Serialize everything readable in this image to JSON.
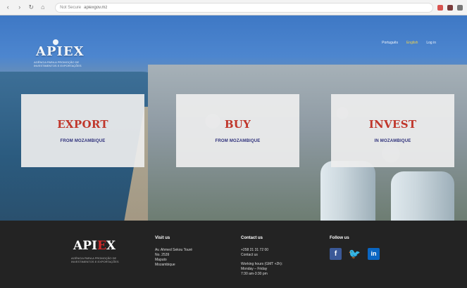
{
  "browser": {
    "address": "apiexgov.mz",
    "secure_label": "Not Secure",
    "nav": {
      "back": "‹",
      "forward": "›",
      "refresh": "↻",
      "home": "⌂"
    },
    "icon_colors": [
      "#d9534f",
      "#7a3b3b",
      "#777777"
    ]
  },
  "header": {
    "logo_text": "APIEX",
    "logo_sub": "AGÊNCIA PARA A PROMOÇÃO DE INVESTIMENTOS E EXPORTAÇÕES",
    "links": [
      {
        "label": "Português",
        "active": false
      },
      {
        "label": "English",
        "active": true
      },
      {
        "label": "Log in",
        "active": false
      }
    ]
  },
  "cards": [
    {
      "title": "EXPORT",
      "subtitle": "FROM MOZAMBIQUE"
    },
    {
      "title": "BUY",
      "subtitle": "FROM MOZAMBIQUE"
    },
    {
      "title": "INVEST",
      "subtitle": "IN MOZAMBIQUE"
    }
  ],
  "footer": {
    "logo_text": {
      "prefix": "API",
      "accent": "E",
      "suffix": "X"
    },
    "logo_tag": "AGÊNCIA PARA A PROMOÇÃO DE INVESTIMENTOS E EXPORTAÇÕES",
    "visit": {
      "title": "Visit us",
      "lines": [
        "Av. Ahmed Sekou Touré",
        "No. 2539",
        "Maputo",
        "Mozambique"
      ]
    },
    "contact": {
      "title": "Contact us",
      "lines": [
        "+258 21 31 72 00",
        "Contact us"
      ],
      "hours_lines": [
        "Working hours (GMT +2h):",
        "Monday – Friday",
        "7:30 am-3:30 pm"
      ]
    },
    "follow": {
      "title": "Follow us",
      "icons": [
        "facebook-icon",
        "twitter-icon",
        "linkedin-icon"
      ]
    }
  },
  "colors": {
    "accent_red": "#c0362b",
    "accent_blue": "#2d2f7a",
    "footer_bg": "#232323"
  }
}
